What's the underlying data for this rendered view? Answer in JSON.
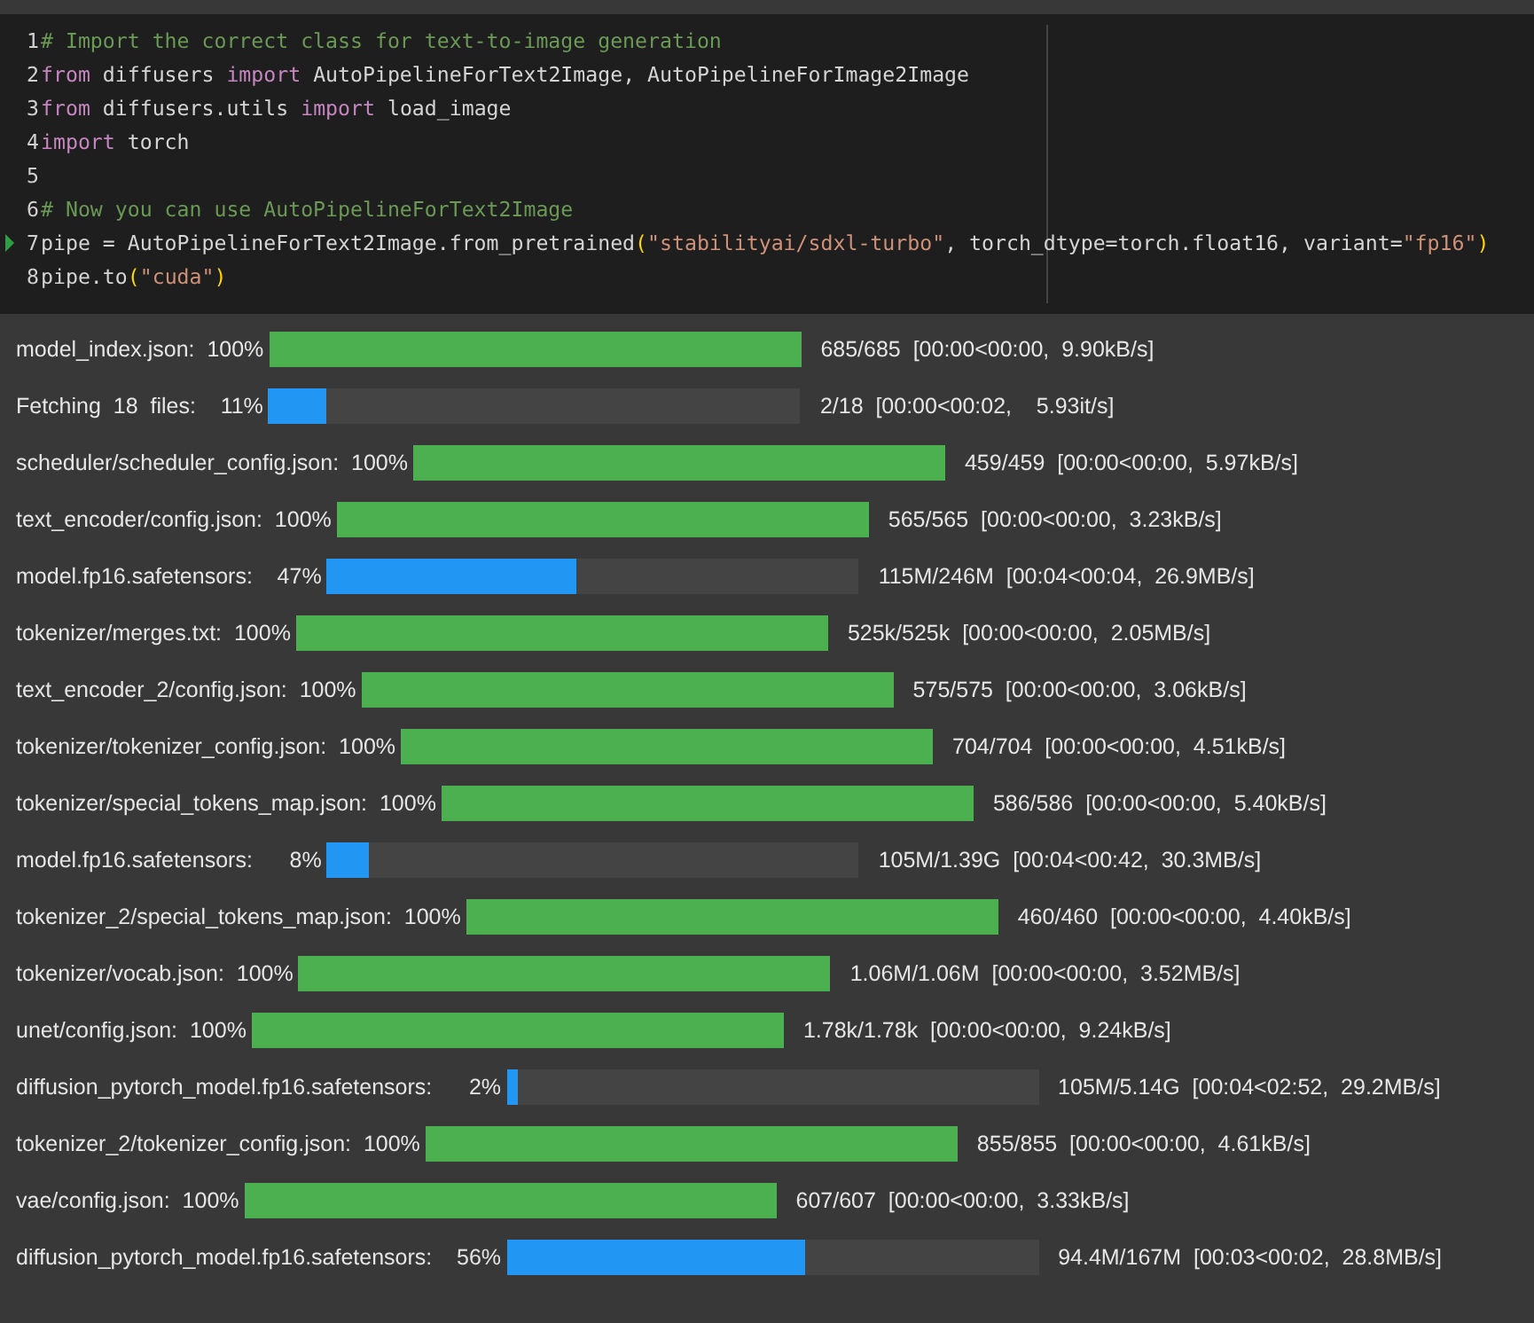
{
  "code_cell": {
    "lines": [
      {
        "number": "1",
        "current": false,
        "tokens": [
          {
            "kind": "comment",
            "text": "# Import the correct class for text-to-image generation"
          }
        ]
      },
      {
        "number": "2",
        "current": false,
        "tokens": [
          {
            "kind": "keyword",
            "text": "from"
          },
          {
            "kind": "plain",
            "text": " diffusers "
          },
          {
            "kind": "keyword",
            "text": "import"
          },
          {
            "kind": "plain",
            "text": " AutoPipelineForText2Image, AutoPipelineForImage2Image"
          }
        ]
      },
      {
        "number": "3",
        "current": false,
        "tokens": [
          {
            "kind": "keyword",
            "text": "from"
          },
          {
            "kind": "plain",
            "text": " diffusers.utils "
          },
          {
            "kind": "keyword",
            "text": "import"
          },
          {
            "kind": "plain",
            "text": " load_image"
          }
        ]
      },
      {
        "number": "4",
        "current": false,
        "tokens": [
          {
            "kind": "keyword",
            "text": "import"
          },
          {
            "kind": "plain",
            "text": " torch"
          }
        ]
      },
      {
        "number": "5",
        "current": false
      },
      {
        "number": "6",
        "current": false,
        "tokens": [
          {
            "kind": "comment",
            "text": "# Now you can use AutoPipelineForText2Image"
          }
        ]
      },
      {
        "number": "7",
        "current": true,
        "tokens": [
          {
            "kind": "plain",
            "text": "pipe = AutoPipelineForText2Image.from_pretrained"
          },
          {
            "kind": "paren",
            "text": "("
          },
          {
            "kind": "string",
            "text": "\"stabilityai/sdxl-turbo\""
          },
          {
            "kind": "plain",
            "text": ", torch_dtype=torch.float16, variant="
          },
          {
            "kind": "string",
            "text": "\"fp16\""
          },
          {
            "kind": "paren",
            "text": ")"
          }
        ]
      },
      {
        "number": "8",
        "current": false,
        "tokens": [
          {
            "kind": "plain",
            "text": "pipe.to"
          },
          {
            "kind": "paren",
            "text": "("
          },
          {
            "kind": "string",
            "text": "\"cuda\""
          },
          {
            "kind": "paren",
            "text": ")"
          }
        ]
      }
    ]
  },
  "output": {
    "progress_rows": [
      {
        "label": "model_index.json:  100%",
        "level": 1.0,
        "done": true,
        "status": "685/685  [00:00<00:00,  9.90kB/s]"
      },
      {
        "label": "Fetching  18  files:    11%",
        "level": 0.11,
        "done": false,
        "status": "2/18  [00:00<00:02,    5.93it/s]"
      },
      {
        "label": "scheduler/scheduler_config.json:  100%",
        "level": 1.0,
        "done": true,
        "status": "459/459  [00:00<00:00,  5.97kB/s]"
      },
      {
        "label": "text_encoder/config.json:  100%",
        "level": 1.0,
        "done": true,
        "status": "565/565  [00:00<00:00,  3.23kB/s]"
      },
      {
        "label": "model.fp16.safetensors:    47%",
        "level": 0.47,
        "done": false,
        "status": "115M/246M  [00:04<00:04,  26.9MB/s]"
      },
      {
        "label": "tokenizer/merges.txt:  100%",
        "level": 1.0,
        "done": true,
        "status": "525k/525k  [00:00<00:00,  2.05MB/s]"
      },
      {
        "label": "text_encoder_2/config.json:  100%",
        "level": 1.0,
        "done": true,
        "status": "575/575  [00:00<00:00,  3.06kB/s]"
      },
      {
        "label": "tokenizer/tokenizer_config.json:  100%",
        "level": 1.0,
        "done": true,
        "status": "704/704  [00:00<00:00,  4.51kB/s]"
      },
      {
        "label": "tokenizer/special_tokens_map.json:  100%",
        "level": 1.0,
        "done": true,
        "status": "586/586  [00:00<00:00,  5.40kB/s]"
      },
      {
        "label": "model.fp16.safetensors:      8%",
        "level": 0.08,
        "done": false,
        "status": "105M/1.39G  [00:04<00:42,  30.3MB/s]"
      },
      {
        "label": "tokenizer_2/special_tokens_map.json:  100%",
        "level": 1.0,
        "done": true,
        "status": "460/460  [00:00<00:00,  4.40kB/s]"
      },
      {
        "label": "tokenizer/vocab.json:  100%",
        "level": 1.0,
        "done": true,
        "status": "1.06M/1.06M  [00:00<00:00,  3.52MB/s]"
      },
      {
        "label": "unet/config.json:  100%",
        "level": 1.0,
        "done": true,
        "status": "1.78k/1.78k  [00:00<00:00,  9.24kB/s]"
      },
      {
        "label": "diffusion_pytorch_model.fp16.safetensors:      2%",
        "level": 0.02,
        "done": false,
        "status": "105M/5.14G  [00:04<02:52,  29.2MB/s]"
      },
      {
        "label": "tokenizer_2/tokenizer_config.json:  100%",
        "level": 1.0,
        "done": true,
        "status": "855/855  [00:00<00:00,  4.61kB/s]"
      },
      {
        "label": "vae/config.json:  100%",
        "level": 1.0,
        "done": true,
        "status": "607/607  [00:00<00:00,  3.33kB/s]"
      },
      {
        "label": "diffusion_pytorch_model.fp16.safetensors:    56%",
        "level": 0.56,
        "done": false,
        "status": "94.4M/167M  [00:03<00:02,  28.8MB/s]"
      }
    ]
  }
}
